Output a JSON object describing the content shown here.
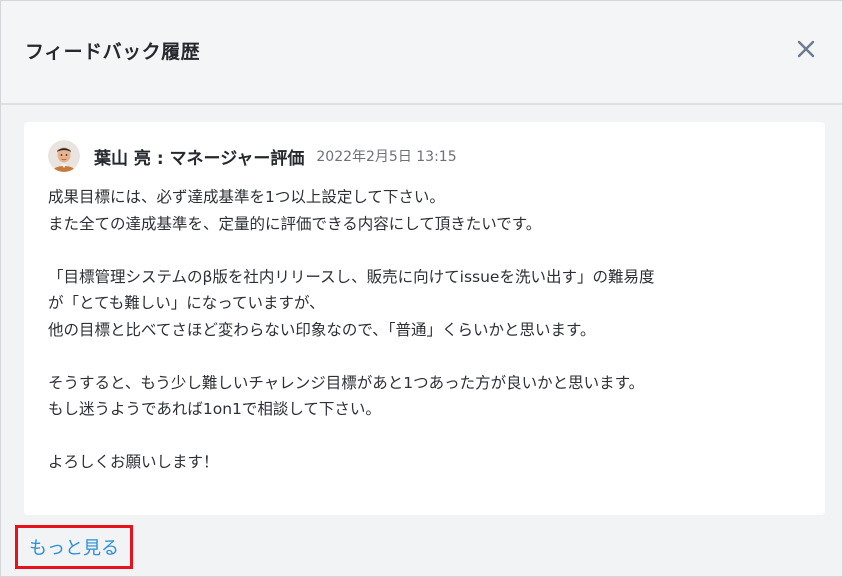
{
  "dialog": {
    "title": "フィードバック履歴",
    "close_icon": "close-icon"
  },
  "feedback": {
    "avatar_icon": "user-avatar",
    "author": "葉山 亮 : マネージャー評価",
    "timestamp": "2022年2月5日 13:15",
    "lines": [
      "成果目標には、必ず達成基準を1つ以上設定して下さい。",
      "また全ての達成基準を、定量的に評価できる内容にして頂きたいです。",
      "",
      "「目標管理システムのβ版を社内リリースし、販売に向けてissueを洗い出す」の難易度",
      "が「とても難しい」になっていますが、",
      "他の目標と比べてさほど変わらない印象なので、「普通」くらいかと思います。",
      "",
      "そうすると、もう少し難しいチャレンジ目標があと1つあった方が良いかと思います。",
      "もし迷うようであれば1on1で相談して下さい。",
      "",
      "よろしくお願いします！"
    ]
  },
  "footer": {
    "more_label": "もっと見る"
  },
  "colors": {
    "link": "#2b8fd9",
    "highlight_border": "#e8121d",
    "background": "#f2f3f5",
    "card": "#ffffff"
  }
}
